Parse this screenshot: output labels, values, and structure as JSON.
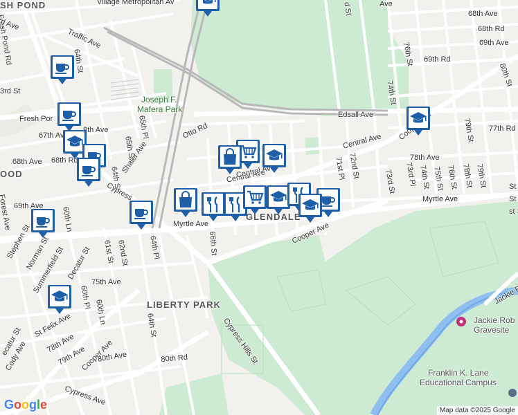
{
  "map": {
    "attribution": "Map data ©2025 Google",
    "logo_letters": [
      "G",
      "o",
      "o",
      "g",
      "l",
      "e"
    ],
    "colors": {
      "land": "#f3f1ee",
      "park": "#cdebd2",
      "water": "#8fbff0",
      "road": "#ffffff",
      "rail": "#b8b8b8",
      "marker": "#1e5fa8"
    }
  },
  "neighborhoods": [
    {
      "key": "glendale",
      "text": "GLENDALE"
    },
    {
      "key": "liberty_park",
      "text": "LIBERTY PARK"
    },
    {
      "key": "ridgewood_fragment",
      "text": "OOD"
    },
    {
      "key": "fresh_pond_fragment",
      "text": "SH POND"
    }
  ],
  "parks": [
    {
      "key": "mafera_line1",
      "text": "Joseph F."
    },
    {
      "key": "mafera_line2",
      "text": "Mafera Park"
    }
  ],
  "pois": [
    {
      "key": "jackie_line1",
      "text": "Jackie Rob"
    },
    {
      "key": "jackie_line2",
      "text": "Gravesite"
    },
    {
      "key": "franklin_line1",
      "text": "Franklin K. Lane"
    },
    {
      "key": "franklin_line2",
      "text": "Educational Campus"
    }
  ],
  "streets": [
    "Village Metropolitan Av",
    "Traffic Ave",
    "Fresh Pond Rd",
    "64th St",
    "Fresh Por",
    "67th Ave",
    "8th Ave",
    "68th Ave",
    "68th Rd",
    "64th St",
    "65th St",
    "65th Pl",
    "Shaler Ave",
    "Otto Rd",
    "Forest Ave",
    "69th Ave",
    "60th Ln",
    "Cypress",
    "Myrtle Ave",
    "66th St",
    "Central Ave",
    "Central Ave",
    "Edsall Ave",
    "Cooper Ave",
    "Cooper Ave",
    "Myrtle Ave",
    "71st Pl",
    "72nd St",
    "73rd St",
    "73rd Pl",
    "74th St",
    "75th St",
    "76th St",
    "78th St",
    "79th St",
    "79th St",
    "78th Ave",
    "77th Rd",
    "80th St",
    "68th Ave",
    "68th Rd",
    "69th Ave",
    "69th Rd",
    "76th St",
    "74th St",
    "Stephen St",
    "Norman St",
    "Summerfield St",
    "Decatur St",
    "61st St",
    "62nd St",
    "64th Pl",
    "75th Ave",
    "60th Pl",
    "60th Ln",
    "St Felix Ave",
    "78th Ave",
    "79th Ave",
    "Cooper Ave",
    "80th Ave",
    "80th Rd",
    "Cypress Hills St",
    "Cypress Ave",
    "64th St",
    "Cody Ave",
    "ecatur St",
    "Jackie Robinson Pkwy",
    "3rd St",
    "rd Ave",
    "d St",
    "St",
    "St",
    "st St",
    "Ave",
    "Central Ave",
    "Myrtle Ave"
  ],
  "markers": [
    {
      "icon": "school-icon"
    },
    {
      "icon": "coffee-icon"
    },
    {
      "icon": "coffee-icon"
    },
    {
      "icon": "school-icon"
    },
    {
      "icon": "coffee-icon"
    },
    {
      "icon": "coffee-icon"
    },
    {
      "icon": "coffee-icon"
    },
    {
      "icon": "coffee-icon"
    },
    {
      "icon": "school-icon"
    },
    {
      "icon": "school-icon"
    },
    {
      "icon": "grocery-icon"
    },
    {
      "icon": "shopping-bag-icon"
    },
    {
      "icon": "school-icon"
    },
    {
      "icon": "shopping-bag-icon"
    },
    {
      "icon": "restaurant-icon"
    },
    {
      "icon": "restaurant-icon"
    },
    {
      "icon": "grocery-icon"
    },
    {
      "icon": "school-icon"
    },
    {
      "icon": "restaurant-icon"
    },
    {
      "icon": "coffee-icon"
    },
    {
      "icon": "school-icon"
    }
  ]
}
